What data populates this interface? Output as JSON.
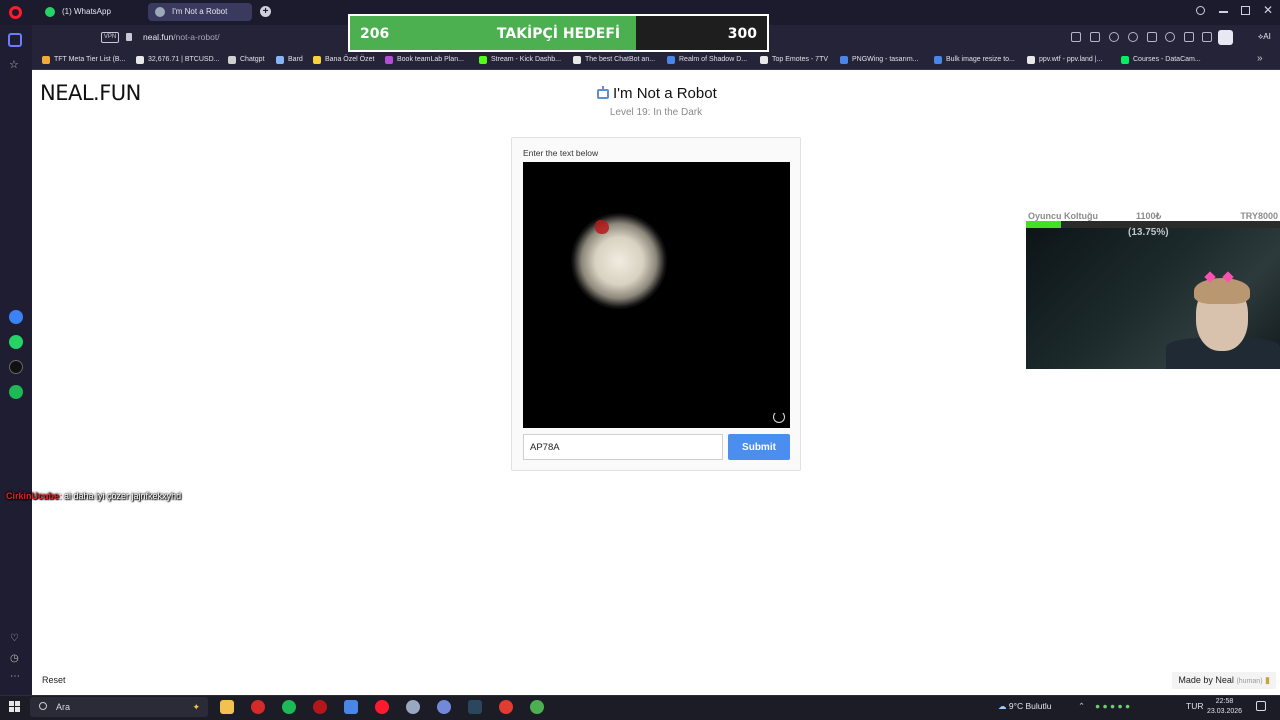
{
  "browser": {
    "tabs": [
      {
        "label": "(1) WhatsApp",
        "color": "#25d366"
      },
      {
        "label": "I'm Not a Robot",
        "color": "#9ea9b8"
      }
    ],
    "url_host": "neal.fun",
    "url_path": "/not-a-robot/",
    "vpn_label": "VPN",
    "bookmarks": [
      {
        "label": "TFT Meta Tier List (B...",
        "color": "#f2a93b"
      },
      {
        "label": "32,676.71 | BTCUSD...",
        "color": "#e8e8e8"
      },
      {
        "label": "Chatgpt",
        "color": "#d0d0d0"
      },
      {
        "label": "Bard",
        "color": "#8ab4f8"
      },
      {
        "label": "Bana Özel Özet",
        "color": "#f7d23e"
      },
      {
        "label": "Book teamLab Plan...",
        "color": "#b44dd8"
      },
      {
        "label": "Stream - Kick Dashb...",
        "color": "#53fc18"
      },
      {
        "label": "The best ChatBot an...",
        "color": "#e8e8e8"
      },
      {
        "label": "Realm of Shadow D...",
        "color": "#4a86e8"
      },
      {
        "label": "Top Emotes - 7TV",
        "color": "#e8e8e8"
      },
      {
        "label": "PNGWing - tasarım...",
        "color": "#4a86e8"
      },
      {
        "label": "Bulk image resize to...",
        "color": "#4a86e8"
      },
      {
        "label": "ppv.wtf - ppv.land |...",
        "color": "#e8e8e8"
      },
      {
        "label": "Courses - DataCam...",
        "color": "#03ef62"
      }
    ],
    "ai_label": "AI"
  },
  "overlay": {
    "followers_current": "206",
    "followers_label": "TAKİPÇİ HEDEFİ",
    "followers_goal": "300",
    "followers_fraction": 0.687,
    "cam_goal_name": "Oyuncu Koltuğu",
    "cam_goal_value": "1100₺",
    "cam_goal_max": "TRY8000",
    "cam_goal_percent": "(13.75%)",
    "chat_user": "CirkinUcube",
    "chat_message": ": ai daha iyi çözer jajnfkekxyhd"
  },
  "page": {
    "logo": "NEAL.FUN",
    "title": "I'm Not a Robot",
    "subtitle": "Level 19: In the Dark",
    "prompt": "Enter the text below",
    "answer_value": "AP78A",
    "submit_label": "Submit",
    "reset_label": "Reset",
    "made_by": "Made by Neal",
    "made_by_note": "(human)"
  },
  "taskbar": {
    "search_placeholder": "Ara",
    "weather": "9°C  Bulutlu",
    "lang": "TUR",
    "time": "22:58",
    "date": "23.03.2026"
  },
  "colors": {
    "accent": "#4a8ef0",
    "follow_fill": "#4caf50",
    "chrome_bg": "#1c1b2e"
  }
}
